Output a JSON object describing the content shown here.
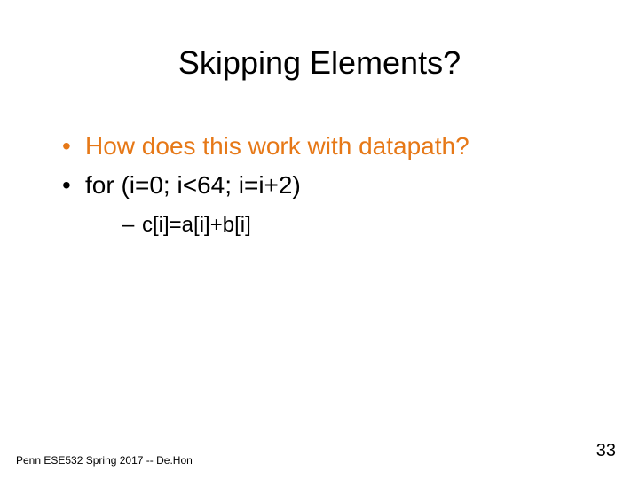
{
  "slide": {
    "title": "Skipping Elements?",
    "bullets": [
      {
        "text": "How does this work with datapath?",
        "accent": true
      },
      {
        "text": "for (i=0; i<64; i=i+2)",
        "accent": false,
        "sub": [
          "c[i]=a[i]+b[i]"
        ]
      }
    ],
    "footer": "Penn ESE532 Spring 2017 -- De.Hon",
    "page": "33"
  }
}
